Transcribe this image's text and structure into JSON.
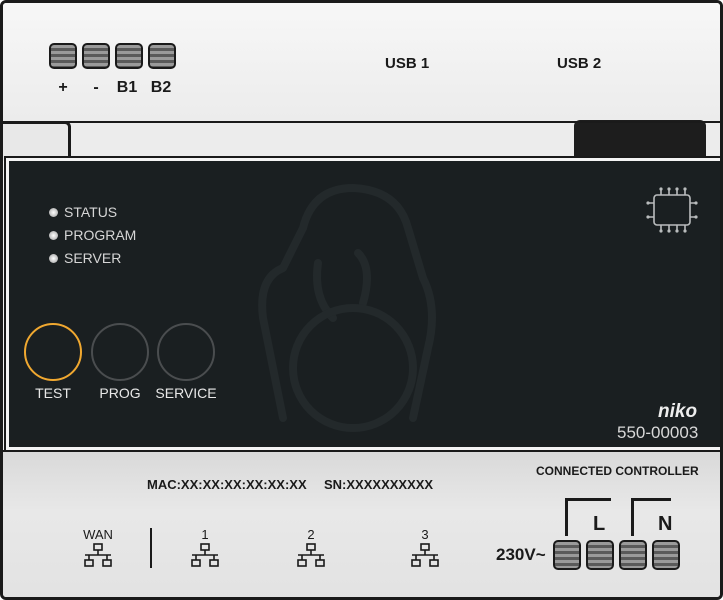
{
  "top_terminals": {
    "labels": [
      "+",
      "-",
      "B1",
      "B2"
    ]
  },
  "usb": {
    "port1": "USB 1",
    "port2": "USB 2"
  },
  "status_leds": [
    {
      "label": "STATUS"
    },
    {
      "label": "PROGRAM"
    },
    {
      "label": "SERVER"
    }
  ],
  "buttons": {
    "test": "TEST",
    "prog": "PROG",
    "service": "SERVICE"
  },
  "brand": {
    "logo": "niko",
    "model": "550-00003"
  },
  "info": {
    "mac": "MAC:XX:XX:XX:XX:XX:XX",
    "sn": "SN:XXXXXXXXXX"
  },
  "network": {
    "wan": "WAN",
    "ports": [
      "1",
      "2",
      "3"
    ]
  },
  "power": {
    "title": "CONNECTED CONTROLLER",
    "voltage": "230V~",
    "l": "L",
    "n": "N"
  },
  "colors": {
    "test_ring": "#f0a830",
    "panel": "#1a1f21"
  }
}
